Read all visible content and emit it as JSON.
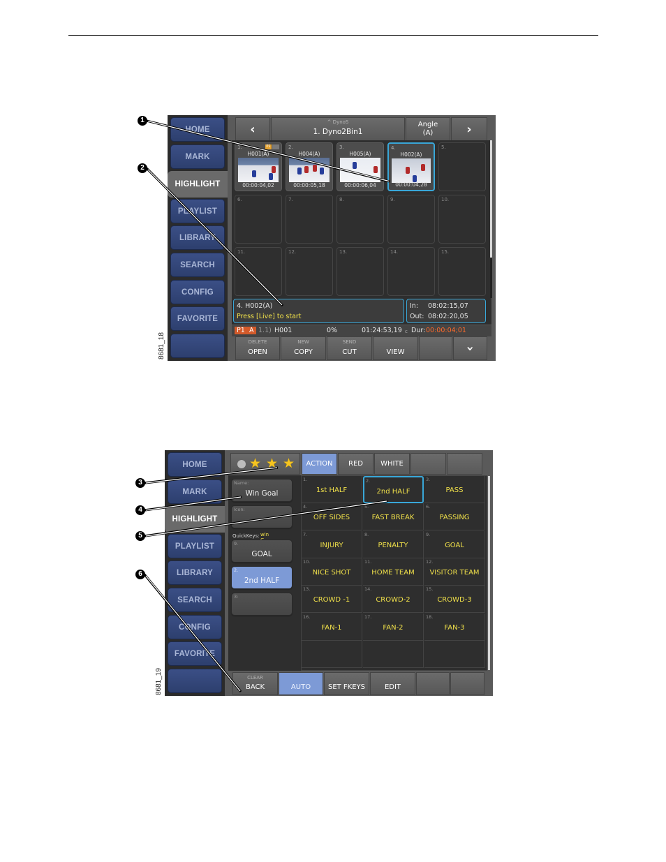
{
  "figure1": {
    "id": "8681_18",
    "nav": [
      "HOME",
      "MARK",
      "HIGHLIGHT",
      "PLAYLIST",
      "LIBRARY",
      "SEARCH",
      "CONFIG",
      "FAVORITE",
      ""
    ],
    "active_nav": "HIGHLIGHT",
    "header": {
      "prev_icon": "chevron-left",
      "bin_parent": "^ DynoS",
      "bin_name": "1. Dyno2Bin1",
      "angle_label": "Angle",
      "angle_value": "(A)",
      "next_icon": "chevron-right"
    },
    "clips": [
      {
        "num": "1.",
        "name": "H001(A)",
        "timecode": "00:00:04,02",
        "badge": "P1"
      },
      {
        "num": "2.",
        "name": "H004(A)",
        "timecode": "00:00:05,18"
      },
      {
        "num": "3.",
        "name": "H005(A)",
        "timecode": "00:00:06,04"
      },
      {
        "num": "4.",
        "name": "H002(A)",
        "timecode": "00:00:04,28",
        "selected": true
      }
    ],
    "empty_cells": [
      "5.",
      "6.",
      "7.",
      "8.",
      "9.",
      "10.",
      "11.",
      "12.",
      "13.",
      "14.",
      "15."
    ],
    "info": {
      "clip": "4. H002(A)",
      "prompt": "Press [Live] to start",
      "in_label": "In:",
      "in_value": "08:02:15,07",
      "out_label": "Out:",
      "out_value": "08:02:20,05"
    },
    "status": {
      "player": "P1",
      "angle": "A",
      "position": "1.1)",
      "clip": "H001",
      "percent": "0%",
      "timecode": "01:24:53,19",
      "tc_suffix": "c",
      "dur_label": "Dur:",
      "dur_value": "00:00:04;01"
    },
    "softkeys": [
      {
        "sub": "DELETE",
        "main": "OPEN"
      },
      {
        "sub": "NEW",
        "main": "COPY"
      },
      {
        "sub": "SEND",
        "main": "CUT"
      },
      {
        "sub": "",
        "main": "VIEW"
      },
      {
        "sub": "",
        "main": ""
      },
      {
        "sub": "",
        "main": "chevron-down"
      }
    ],
    "callouts": [
      "1",
      "2"
    ]
  },
  "figure2": {
    "id": "8681_19",
    "nav": [
      "HOME",
      "MARK",
      "HIGHLIGHT",
      "PLAYLIST",
      "LIBRARY",
      "SEARCH",
      "CONFIG",
      "FAVORITE",
      ""
    ],
    "active_nav": "HIGHLIGHT",
    "rating_stars": 3,
    "tabs": [
      "ACTION",
      "RED",
      "WHITE",
      "",
      ""
    ],
    "active_tab": "ACTION",
    "name_caption": "Name:",
    "name_value": "Win Goal",
    "icon_caption": "Icon:",
    "icon_value": "",
    "quickkeys_label": "QuickKeys:",
    "quickkeys_value": "win G",
    "quickkeys": [
      {
        "num": "9.",
        "label": "GOAL"
      },
      {
        "num": "2.",
        "label": "2nd HALF",
        "selected": true
      },
      {
        "num": "3:",
        "label": ""
      }
    ],
    "keywords": [
      {
        "num": "1.",
        "label": "1st HALF"
      },
      {
        "num": "2.",
        "label": "2nd HALF",
        "selected": true
      },
      {
        "num": "3.",
        "label": "PASS"
      },
      {
        "num": "4.",
        "label": "OFF SIDES"
      },
      {
        "num": "5.",
        "label": "FAST BREAK"
      },
      {
        "num": "6.",
        "label": "PASSING"
      },
      {
        "num": "7.",
        "label": "INJURY"
      },
      {
        "num": "8.",
        "label": "PENALTY"
      },
      {
        "num": "9.",
        "label": "GOAL"
      },
      {
        "num": "10.",
        "label": "NICE SHOT"
      },
      {
        "num": "11.",
        "label": "HOME TEAM"
      },
      {
        "num": "12.",
        "label": "VISITOR TEAM"
      },
      {
        "num": "13.",
        "label": "CROWD -1"
      },
      {
        "num": "14.",
        "label": "CROWD-2"
      },
      {
        "num": "15.",
        "label": "CROWD-3"
      },
      {
        "num": "16.",
        "label": "FAN-1"
      },
      {
        "num": "17.",
        "label": "FAN-2"
      },
      {
        "num": "18.",
        "label": "FAN-3"
      },
      {
        "num": "",
        "label": ""
      },
      {
        "num": "",
        "label": ""
      },
      {
        "num": "",
        "label": ""
      }
    ],
    "softkeys": [
      {
        "sub": "CLEAR",
        "main": "BACK"
      },
      {
        "sub": "",
        "main": "AUTO",
        "active": true
      },
      {
        "sub": "",
        "main": "SET FKEYS"
      },
      {
        "sub": "",
        "main": "EDIT"
      },
      {
        "sub": "",
        "main": ""
      },
      {
        "sub": "",
        "main": ""
      }
    ],
    "callouts": [
      "3",
      "4",
      "5",
      "6"
    ]
  },
  "colors": {
    "nav_blue": "#2d3f6e",
    "accent_blue": "#7d9ad6",
    "selection_cyan": "#39a7d8",
    "keyword_yellow": "#f0e04a",
    "duration_orange": "#ff6a2a",
    "panel_dark": "#2e2e2e"
  }
}
